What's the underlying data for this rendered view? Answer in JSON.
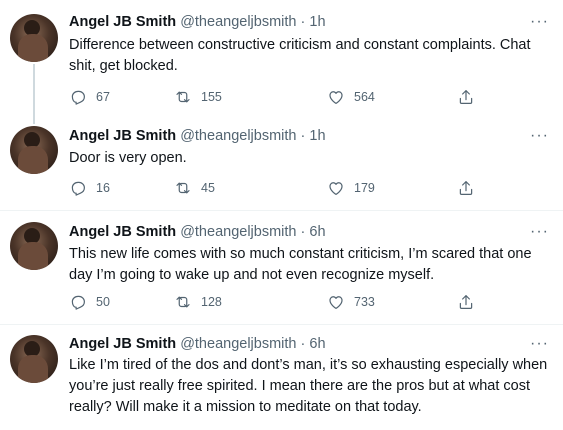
{
  "tweets": [
    {
      "name": "Angel JB Smith",
      "handle": "@theangeljbsmith",
      "time": "1h",
      "text": "Difference between constructive criticism and constant complaints. Chat shit, get blocked.",
      "replies": "67",
      "retweets": "155",
      "likes": "564"
    },
    {
      "name": "Angel JB Smith",
      "handle": "@theangeljbsmith",
      "time": "1h",
      "text": "Door is very open.",
      "replies": "16",
      "retweets": "45",
      "likes": "179"
    },
    {
      "name": "Angel JB Smith",
      "handle": "@theangeljbsmith",
      "time": "6h",
      "text": "This new life comes with so much constant criticism, I’m scared that one day I’m going to wake up and not even recognize myself.",
      "replies": "50",
      "retweets": "128",
      "likes": "733"
    },
    {
      "name": "Angel JB Smith",
      "handle": "@theangeljbsmith",
      "time": "6h",
      "text": "Like I’m tired of the dos and dont’s man, it’s so exhausting especially when you’re just really free spirited. I mean there are the pros but at what cost really? Will make it a mission to meditate on that today."
    }
  ],
  "separator": " · ",
  "more_label": "···",
  "icons": {
    "reply": "reply-icon",
    "retweet": "retweet-icon",
    "like": "like-icon",
    "share": "share-icon",
    "more": "more-icon"
  },
  "colors": {
    "text": "#0f1419",
    "secondary": "#536471",
    "thread_line": "#cfd9de",
    "divider": "#eff3f4"
  }
}
